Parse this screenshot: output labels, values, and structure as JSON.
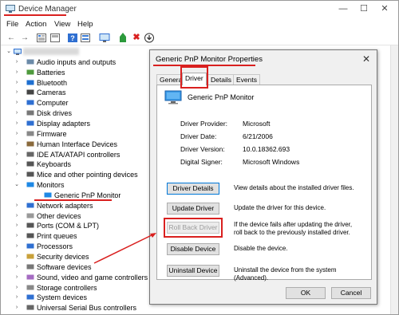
{
  "window": {
    "title": "Device Manager",
    "minimize_glyph": "—",
    "maximize_glyph": "☐",
    "close_glyph": "✕"
  },
  "menu": [
    "File",
    "Action",
    "View",
    "Help"
  ],
  "toolbar_icons": [
    "back-arrow-icon",
    "forward-arrow-icon",
    "properties-icon",
    "show-hide-icon",
    "help-icon",
    "update-list-icon",
    "monitor-icon",
    "add-driver-icon",
    "uninstall-icon",
    "download-icon"
  ],
  "tree": {
    "root_expander": "⌄",
    "collapsed_glyph": "›",
    "expanded_glyph": "⌄",
    "items": [
      {
        "label": "Audio inputs and outputs",
        "expanded": false
      },
      {
        "label": "Batteries",
        "expanded": false
      },
      {
        "label": "Bluetooth",
        "expanded": false
      },
      {
        "label": "Cameras",
        "expanded": false
      },
      {
        "label": "Computer",
        "expanded": false
      },
      {
        "label": "Disk drives",
        "expanded": false
      },
      {
        "label": "Display adapters",
        "expanded": false
      },
      {
        "label": "Firmware",
        "expanded": false
      },
      {
        "label": "Human Interface Devices",
        "expanded": false
      },
      {
        "label": "IDE ATA/ATAPI controllers",
        "expanded": false
      },
      {
        "label": "Keyboards",
        "expanded": false
      },
      {
        "label": "Mice and other pointing devices",
        "expanded": false
      },
      {
        "label": "Monitors",
        "expanded": true
      },
      {
        "label": "Generic PnP Monitor",
        "child": true
      },
      {
        "label": "Network adapters",
        "expanded": false
      },
      {
        "label": "Other devices",
        "expanded": false
      },
      {
        "label": "Ports (COM & LPT)",
        "expanded": false
      },
      {
        "label": "Print queues",
        "expanded": false
      },
      {
        "label": "Processors",
        "expanded": false
      },
      {
        "label": "Security devices",
        "expanded": false
      },
      {
        "label": "Software devices",
        "expanded": false
      },
      {
        "label": "Sound, video and game controllers",
        "expanded": false
      },
      {
        "label": "Storage controllers",
        "expanded": false
      },
      {
        "label": "System devices",
        "expanded": false
      },
      {
        "label": "Universal Serial Bus controllers",
        "expanded": false
      }
    ]
  },
  "dialog": {
    "title": "Generic PnP Monitor Properties",
    "close_glyph": "✕",
    "tabs": [
      "General",
      "Driver",
      "Details",
      "Events"
    ],
    "active_tab": "Driver",
    "device_name": "Generic PnP Monitor",
    "properties": [
      {
        "label": "Driver Provider:",
        "value": "Microsoft"
      },
      {
        "label": "Driver Date:",
        "value": "6/21/2006"
      },
      {
        "label": "Driver Version:",
        "value": "10.0.18362.693"
      },
      {
        "label": "Digital Signer:",
        "value": "Microsoft Windows"
      }
    ],
    "buttons": [
      {
        "label": "Driver Details",
        "desc": "View details about the installed driver files."
      },
      {
        "label": "Update Driver",
        "desc": "Update the driver for this device."
      },
      {
        "label": "Roll Back Driver",
        "desc": "If the device fails after updating the driver, roll back to the previously installed driver.",
        "disabled": true
      },
      {
        "label": "Disable Device",
        "desc": "Disable the device."
      },
      {
        "label": "Uninstall Device",
        "desc": "Uninstall the device from the system (Advanced)."
      }
    ],
    "ok_label": "OK",
    "cancel_label": "Cancel"
  },
  "colors": {
    "annotation_red": "#d9201f",
    "focus_blue": "#0078d7",
    "monitor_blue": "#1e88e5"
  }
}
